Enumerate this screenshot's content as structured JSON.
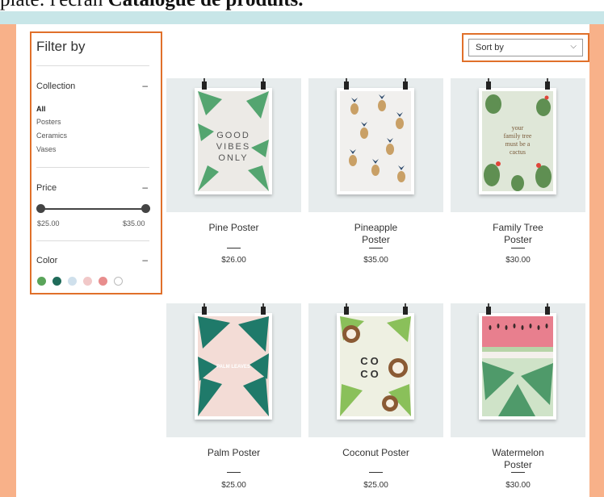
{
  "caption": {
    "prefix": "plate: ",
    "lead": "l'écran ",
    "bold": "Catalogue de produits."
  },
  "filter": {
    "title": "Filter by",
    "collection_label": "Collection",
    "collection_minus": "–",
    "collection_items": [
      "All",
      "Posters",
      "Ceramics",
      "Vases"
    ],
    "price_label": "Price",
    "price_minus": "–",
    "price_min": "$25.00",
    "price_max": "$35.00",
    "price_range_selected": [
      25,
      35
    ],
    "color_label": "Color",
    "color_minus": "–",
    "colors": [
      "#5aa45a",
      "#1f6b5a",
      "#cfe0ec",
      "#f1c8c8",
      "#e88d8d",
      "#ffffff"
    ]
  },
  "sort": {
    "label": "Sort by",
    "chevron_icon": "chevron-down-icon",
    "chevron_glyph": "⌵"
  },
  "products": [
    {
      "name": "Pine Poster",
      "price": "$26.00",
      "poster_text": [
        "GOOD",
        "VIBES",
        "ONLY"
      ]
    },
    {
      "name": "Pineapple Poster",
      "price": "$35.00",
      "poster_text": []
    },
    {
      "name": "Family Tree Poster",
      "price": "$30.00",
      "poster_text": [
        "your",
        "family tree",
        "must be a",
        "cactus"
      ]
    },
    {
      "name": "Palm Poster",
      "price": "$25.00",
      "poster_text": [
        "PALM LEAVES"
      ]
    },
    {
      "name": "Coconut Poster",
      "price": "$25.00",
      "poster_text": [
        "CO",
        "CO"
      ]
    },
    {
      "name": "Watermelon Poster",
      "price": "$30.00",
      "poster_text": []
    }
  ]
}
